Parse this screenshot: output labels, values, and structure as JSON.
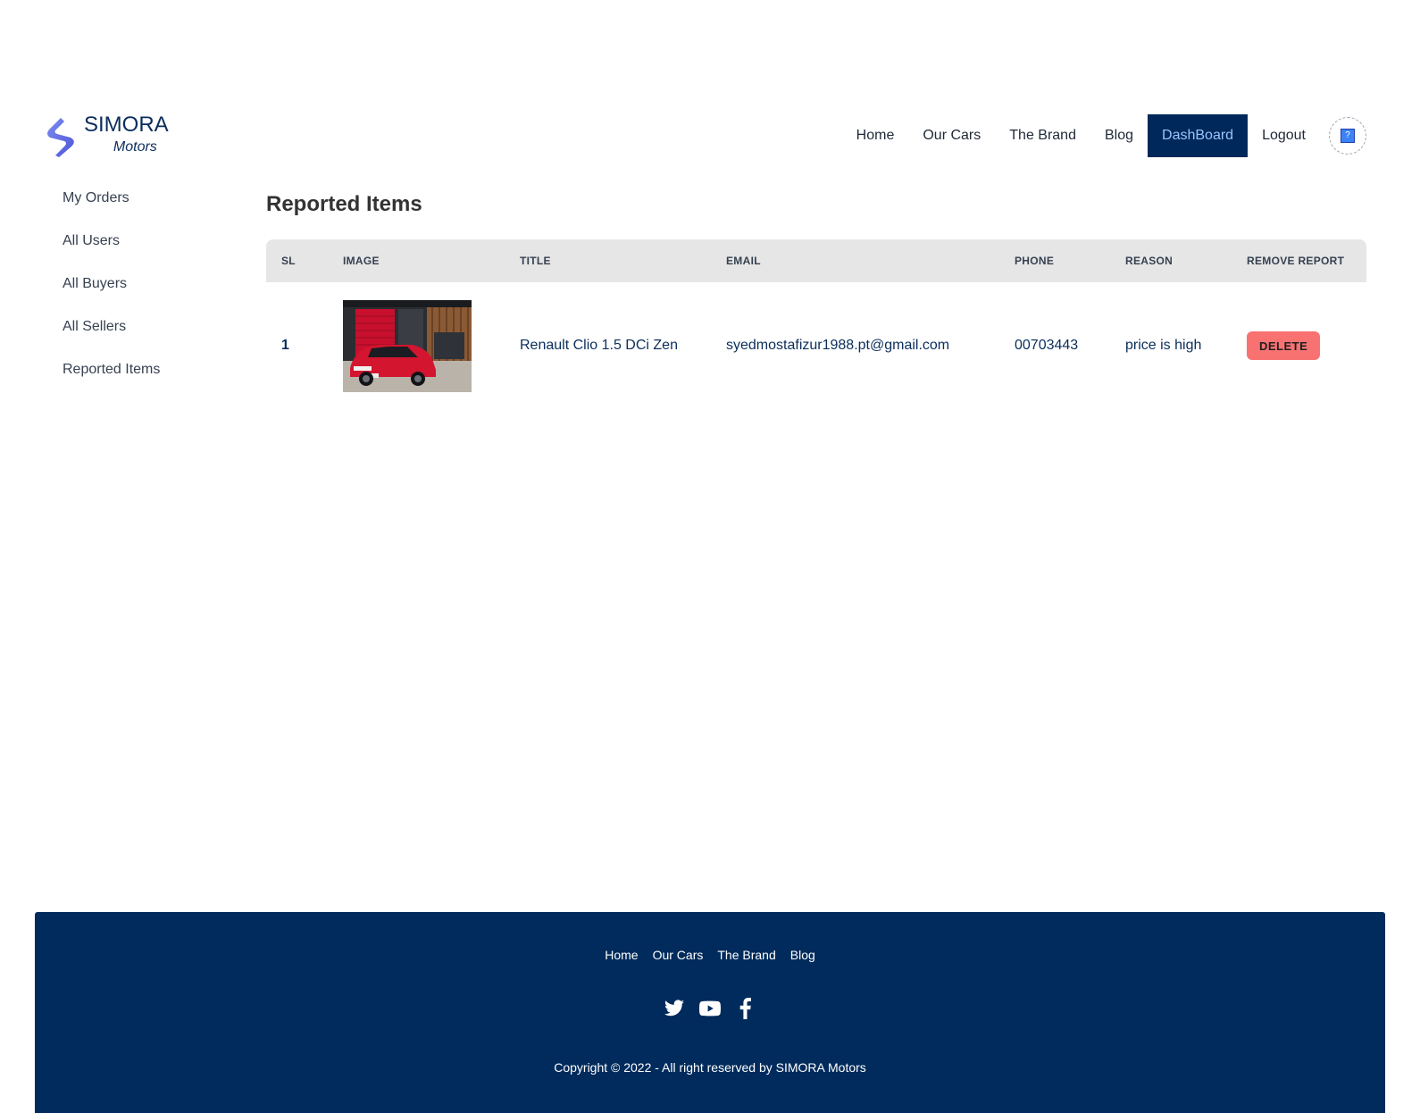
{
  "brand": {
    "name": "SIMORA",
    "sub": "Motors"
  },
  "nav": {
    "home": "Home",
    "our_cars": "Our Cars",
    "the_brand": "The Brand",
    "blog": "Blog",
    "dashboard": "DashBoard",
    "logout": "Logout"
  },
  "sidebar": {
    "items": [
      {
        "label": "My Orders"
      },
      {
        "label": "All Users"
      },
      {
        "label": "All Buyers"
      },
      {
        "label": "All Sellers"
      },
      {
        "label": "Reported Items"
      }
    ]
  },
  "main": {
    "title": "Reported Items",
    "columns": [
      "SL",
      "IMAGE",
      "TITLE",
      "EMAIL",
      "PHONE",
      "REASON",
      "REMOVE REPORT"
    ],
    "rows": [
      {
        "sl": "1",
        "title": "Renault Clio 1.5 DCi Zen",
        "email": "syedmostafizur1988.pt@gmail.com",
        "phone": "00703443",
        "reason": "price is high",
        "action": "DELETE"
      }
    ]
  },
  "footer": {
    "links": [
      "Home",
      "Our Cars",
      "The Brand",
      "Blog"
    ],
    "social": [
      "twitter-icon",
      "youtube-icon",
      "facebook-icon"
    ],
    "copyright": "Copyright © 2022 - All right reserved by SIMORA Motors"
  },
  "colors": {
    "primary": "#00285a",
    "footer_bg": "#002b5c",
    "delete": "#f87272",
    "table_header": "#e6e6e6"
  }
}
